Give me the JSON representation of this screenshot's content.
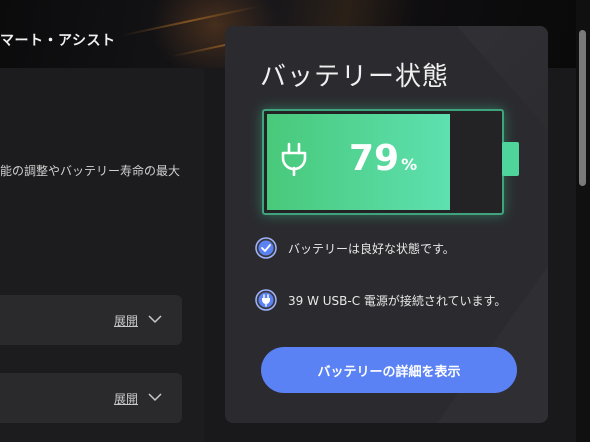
{
  "app": {
    "title": "マート・アシスト"
  },
  "main": {
    "description": "能の調整やバッテリー寿命の最大",
    "cards": [
      {
        "expand_label": "展開"
      },
      {
        "expand_label": "展開"
      }
    ]
  },
  "battery": {
    "title": "バッテリー状態",
    "percent_value": "79",
    "percent_sign": "%",
    "level": 0.79,
    "status": [
      {
        "icon": "check-circle-icon",
        "text": "バッテリーは良好な状態です。"
      },
      {
        "icon": "plug-circle-icon",
        "text": "39 W USB-C 電源が接続されています。"
      }
    ],
    "details_button": "バッテリーの詳細を表示",
    "colors": {
      "fill_start": "#48c97a",
      "fill_end": "#5ee0b0",
      "button": "#5b82f5"
    }
  }
}
